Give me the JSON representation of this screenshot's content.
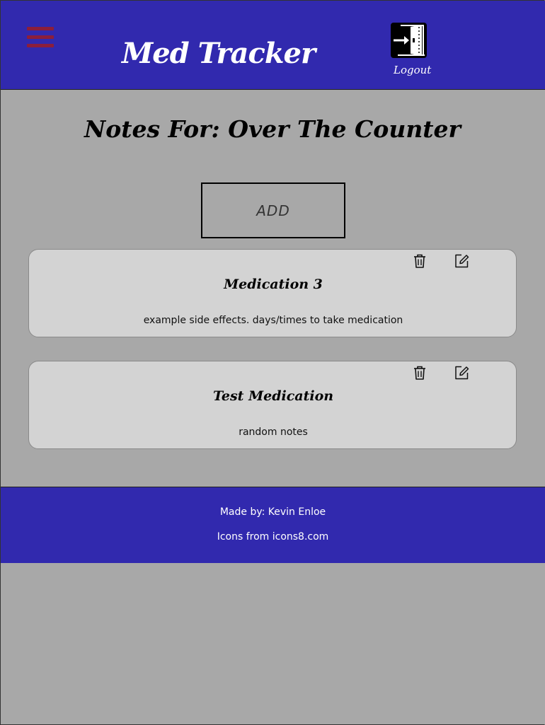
{
  "header": {
    "title": "Med Tracker",
    "logout_label": "Logout",
    "menu_icon": "hamburger-menu-icon",
    "logout_icon": "exit-door-icon",
    "menu_color": "#8b1e3c"
  },
  "main": {
    "heading": "Notes For: Over The Counter",
    "add_button_label": "ADD",
    "notes": [
      {
        "title": "Medication 3",
        "body": "example side effects. days/times to take medication"
      },
      {
        "title": "Test Medication",
        "body": "random notes"
      }
    ],
    "note_action_icons": [
      "trash-icon",
      "edit-icon"
    ]
  },
  "footer": {
    "made_by": "Made by: Kevin Enloe",
    "icons_credit": "Icons from icons8.com"
  },
  "colors": {
    "brand": "#3129ae",
    "background": "#a8a8a8",
    "card": "#d3d3d3"
  }
}
